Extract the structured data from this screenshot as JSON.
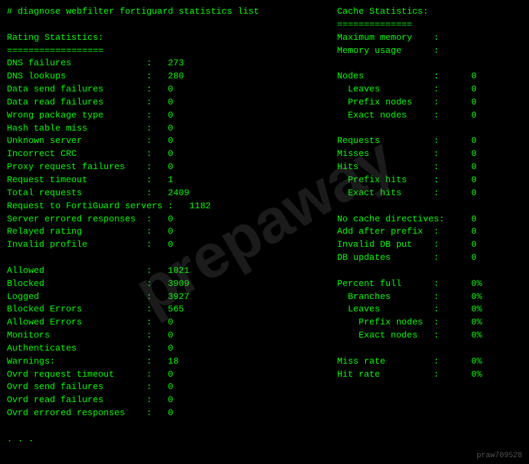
{
  "terminal": {
    "command_line": "# diagnose webfilter fortiguard statistics list",
    "watermark": "prepaway",
    "footer_id": "praw709528",
    "left": {
      "sections": [
        {
          "header": "Rating Statistics:",
          "separator": "==================",
          "items": [
            {
              "label": "DNS failures",
              "colon": ":",
              "value": "273"
            },
            {
              "label": "DNS lookups",
              "colon": ":",
              "value": "280"
            },
            {
              "label": "Data send failures",
              "colon": ":",
              "value": "0"
            },
            {
              "label": "Data read failures",
              "colon": ":",
              "value": "0"
            },
            {
              "label": "Wrong package type",
              "colon": ":",
              "value": "0"
            },
            {
              "label": "Hash table miss",
              "colon": ":",
              "value": "0"
            },
            {
              "label": "Unknown server",
              "colon": ":",
              "value": "0"
            },
            {
              "label": "Incorrect CRC",
              "colon": ":",
              "value": "0"
            },
            {
              "label": "Proxy request failures",
              "colon": ":",
              "value": "0"
            },
            {
              "label": "Request timeout",
              "colon": ":",
              "value": "1"
            },
            {
              "label": "Total requests",
              "colon": ":",
              "value": "2409"
            },
            {
              "label": "Request to FortiGuard servers",
              "colon": ":",
              "value": "1182"
            },
            {
              "label": "Server errored responses",
              "colon": ":",
              "value": "0"
            },
            {
              "label": "Relayed rating",
              "colon": ":",
              "value": "0"
            },
            {
              "label": "Invalid profile",
              "colon": ":",
              "value": "0"
            }
          ]
        },
        {
          "header": "",
          "separator": "",
          "items": [
            {
              "label": "Allowed",
              "colon": ":",
              "value": "1021"
            },
            {
              "label": "Blocked",
              "colon": ":",
              "value": "3909"
            },
            {
              "label": "Logged",
              "colon": ":",
              "value": "3927"
            },
            {
              "label": "Blocked Errors",
              "colon": ":",
              "value": "565"
            },
            {
              "label": "Allowed Errors",
              "colon": ":",
              "value": "0"
            },
            {
              "label": "Monitors",
              "colon": ":",
              "value": "0"
            },
            {
              "label": "Authenticates",
              "colon": ":",
              "value": "0"
            },
            {
              "label": "Warnings:",
              "colon": ":",
              "value": "18"
            },
            {
              "label": "Ovrd request timeout",
              "colon": ":",
              "value": "0"
            },
            {
              "label": "Ovrd send failures",
              "colon": ":",
              "value": "0"
            },
            {
              "label": "Ovrd read failures",
              "colon": ":",
              "value": "0"
            },
            {
              "label": "Ovrd errored responses",
              "colon": ":",
              "value": "0"
            }
          ]
        }
      ],
      "footer": ". . ."
    },
    "right": {
      "header": "Cache Statistics:",
      "separator": "==============",
      "groups": [
        {
          "items": [
            {
              "label": "Maximum memory",
              "colon": ":",
              "value": ""
            },
            {
              "label": "Memory usage",
              "colon": ":",
              "value": ""
            }
          ]
        },
        {
          "items": [
            {
              "label": "Nodes",
              "colon": ":",
              "value": "0"
            },
            {
              "label": "  Leaves",
              "colon": ":",
              "value": "0"
            },
            {
              "label": "  Prefix nodes",
              "colon": ":",
              "value": "0"
            },
            {
              "label": "  Exact nodes",
              "colon": ":",
              "value": "0"
            }
          ]
        },
        {
          "items": [
            {
              "label": "Requests",
              "colon": ":",
              "value": "0"
            },
            {
              "label": "Misses",
              "colon": ":",
              "value": "0"
            },
            {
              "label": "Hits",
              "colon": ":",
              "value": "0"
            },
            {
              "label": "  Prefix hits",
              "colon": ":",
              "value": "0"
            },
            {
              "label": "  Exact hits",
              "colon": ":",
              "value": "0"
            }
          ]
        },
        {
          "items": [
            {
              "label": "No cache directives:",
              "colon": "",
              "value": "0"
            },
            {
              "label": "Add after prefix",
              "colon": ":",
              "value": "0"
            },
            {
              "label": "Invalid DB put",
              "colon": ":",
              "value": "0"
            },
            {
              "label": "DB updates",
              "colon": ":",
              "value": "0"
            }
          ]
        },
        {
          "items": [
            {
              "label": "Percent full",
              "colon": ":",
              "value": "0%"
            },
            {
              "label": "  Branches",
              "colon": ":",
              "value": "0%"
            },
            {
              "label": "  Leaves",
              "colon": ":",
              "value": "0%"
            },
            {
              "label": "    Prefix nodes",
              "colon": ":",
              "value": "0%"
            },
            {
              "label": "    Exact nodes",
              "colon": ":",
              "value": "0%"
            }
          ]
        },
        {
          "items": [
            {
              "label": "Miss rate",
              "colon": ":",
              "value": "0%"
            },
            {
              "label": "Hit rate",
              "colon": ":",
              "value": "0%"
            }
          ]
        }
      ]
    }
  }
}
